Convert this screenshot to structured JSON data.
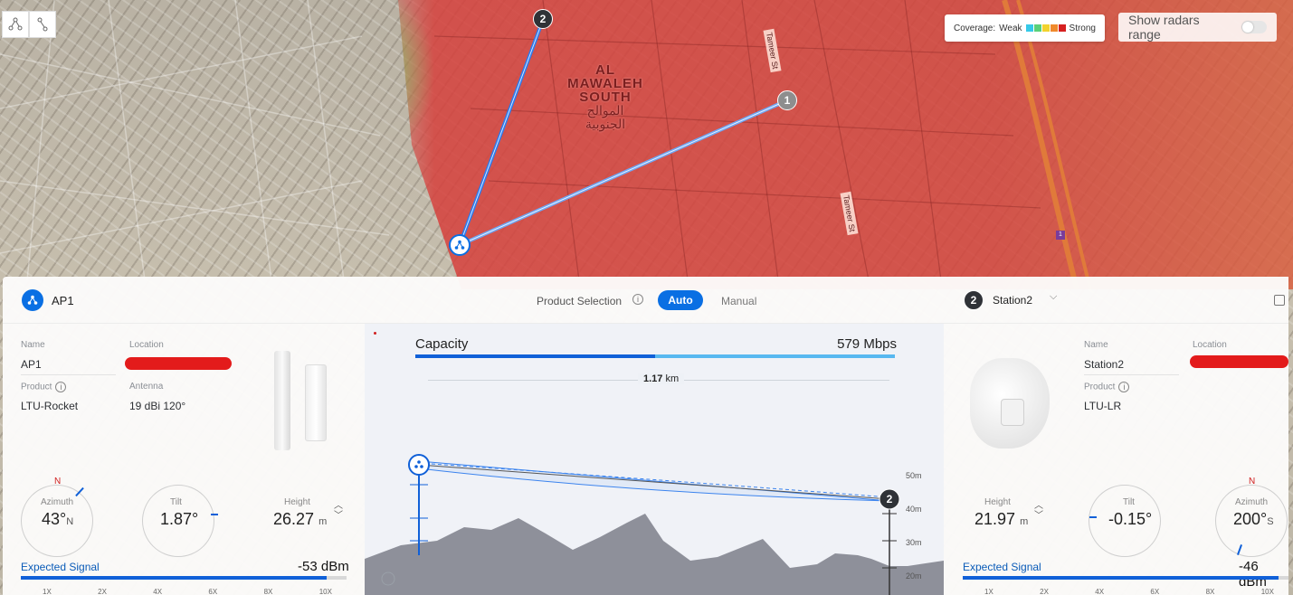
{
  "map": {
    "place_label_en": "AL MAWALEH\nSOUTH",
    "place_label_ar": "الموالح\nالجنوبية",
    "streets": [
      "Tameer St",
      "Tameer St"
    ],
    "nodes": [
      {
        "label": "1",
        "kind": "station"
      },
      {
        "label": "2",
        "kind": "station"
      },
      {
        "label": "",
        "kind": "access-point"
      }
    ],
    "coverage_legend": {
      "prefix": "Coverage:",
      "weak": "Weak",
      "strong": "Strong",
      "colors": [
        "#36c9e8",
        "#5ad07a",
        "#f2d22e",
        "#f08a2c",
        "#d62020"
      ]
    },
    "radar_toggle": {
      "label": "Show radars range",
      "on": false
    },
    "route_badge": "1",
    "colors": {
      "link": "#2a7cf0",
      "coverage": "#d6403c"
    }
  },
  "toolbar": {
    "tools": [
      {
        "icon": "topology-icon"
      },
      {
        "icon": "link-icon"
      }
    ]
  },
  "panel": {
    "left": {
      "title": "AP1",
      "name_label": "Name",
      "name_value": "AP1",
      "location_label": "Location",
      "product_label": "Product",
      "product_value": "LTU-Rocket",
      "antenna_label": "Antenna",
      "antenna_value": "19 dBi 120°",
      "azimuth_label": "Azimuth",
      "azimuth_value": "43°",
      "azimuth_unit": "N",
      "north": "N",
      "tilt_label": "Tilt",
      "tilt_value": "1.87°",
      "height_label": "Height",
      "height_value": "26.27",
      "height_unit": "m",
      "signal_label": "Expected Signal",
      "signal_value": "-53 dBm",
      "signal_level": 0.94,
      "scale": [
        "1X",
        "2X",
        "4X",
        "6X",
        "8X",
        "10X"
      ]
    },
    "product_selection": {
      "label": "Product Selection",
      "auto": "Auto",
      "manual": "Manual",
      "selected": "Auto"
    },
    "center": {
      "capacity_label": "Capacity",
      "capacity_value": "579 Mbps",
      "capacity_fill": 0.5,
      "distance_value": "1.17",
      "distance_unit": "km",
      "heights": [
        "50m",
        "40m",
        "30m",
        "20m"
      ],
      "end_badge": "2"
    },
    "right": {
      "title": "Station2",
      "badge": "2",
      "name_label": "Name",
      "name_value": "Station2",
      "location_label": "Location",
      "product_label": "Product",
      "product_value": "LTU-LR",
      "azimuth_label": "Azimuth",
      "azimuth_value": "200°",
      "azimuth_unit": "S",
      "north": "N",
      "tilt_label": "Tilt",
      "tilt_value": "-0.15°",
      "height_label": "Height",
      "height_value": "21.97",
      "height_unit": "m",
      "signal_label": "Expected Signal",
      "signal_value": "-46 dBm",
      "signal_level": 0.97,
      "scale": [
        "1X",
        "2X",
        "4X",
        "6X",
        "8X",
        "10X"
      ]
    }
  }
}
